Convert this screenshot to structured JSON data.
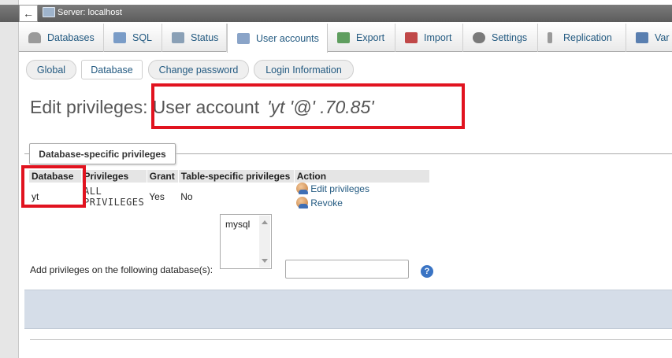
{
  "header": {
    "back_glyph": "←",
    "server_label": "Server: localhost"
  },
  "tabs": [
    {
      "label": "Databases",
      "icon": "database-icon",
      "color": "#8b8b8b"
    },
    {
      "label": "SQL",
      "icon": "sql-icon",
      "color": "#7a9cc7"
    },
    {
      "label": "Status",
      "icon": "status-icon",
      "color": "#8aa0b6"
    },
    {
      "label": "User accounts",
      "icon": "users-icon",
      "color": "#8aa4c8"
    },
    {
      "label": "Export",
      "icon": "export-icon",
      "color": "#5f9e5f"
    },
    {
      "label": "Import",
      "icon": "import-icon",
      "color": "#c04848"
    },
    {
      "label": "Settings",
      "icon": "wrench-icon",
      "color": "#7a7a7a"
    },
    {
      "label": "Replication",
      "icon": "replication-icon",
      "color": "#9a9a9a"
    },
    {
      "label": "Var",
      "icon": "variables-icon",
      "color": "#5a7fb0"
    }
  ],
  "subtabs": [
    {
      "label": "Global"
    },
    {
      "label": "Database"
    },
    {
      "label": "Change password"
    },
    {
      "label": "Login Information"
    }
  ],
  "heading": {
    "prefix": "Edit privileges:",
    "user_account_label": "User account",
    "account": "'yt       '@'         .70.85'"
  },
  "section": {
    "legend": "Database-specific privileges"
  },
  "table": {
    "headers": [
      "Database",
      "Privileges",
      "Grant",
      "Table-specific privileges",
      "Action"
    ],
    "rows": [
      {
        "database": "yt",
        "privileges": "ALL PRIVILEGES",
        "grant": "Yes",
        "table_specific": "No",
        "edit_label": "Edit privileges",
        "revoke_label": "Revoke"
      }
    ]
  },
  "add_privileges": {
    "label": "Add privileges on the following database(s):",
    "db_options": [
      "mysql"
    ],
    "input_value": ""
  },
  "help_glyph": "?",
  "colors": {
    "annotation_red": "#e1131f",
    "link": "#235a81"
  }
}
